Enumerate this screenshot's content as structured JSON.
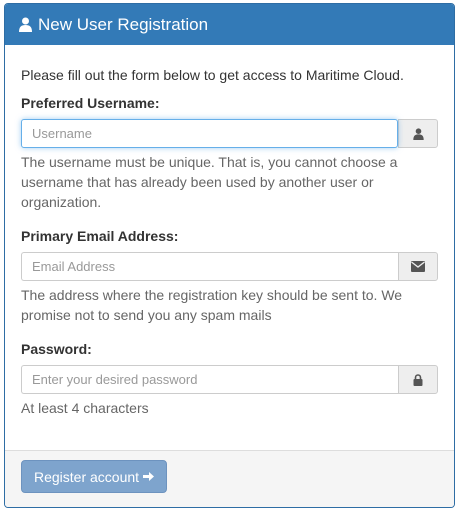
{
  "panel": {
    "title": "New User Registration",
    "title_icon": "user-icon"
  },
  "intro": "Please fill out the form below to get access to Maritime Cloud.",
  "username": {
    "label": "Preferred Username:",
    "placeholder": "Username",
    "value": "",
    "icon": "user-icon",
    "help": "The username must be unique. That is, you cannot choose a username that has already been used by another user or organization."
  },
  "email": {
    "label": "Primary Email Address:",
    "placeholder": "Email Address",
    "value": "",
    "icon": "envelope-icon",
    "help": "The address where the registration key should be sent to. We promise not to send you any spam mails"
  },
  "password": {
    "label": "Password:",
    "placeholder": "Enter your desired password",
    "value": "",
    "icon": "lock-icon",
    "help": "At least 4 characters"
  },
  "footer": {
    "register_label": "Register account",
    "register_icon": "arrow-right-icon"
  },
  "colors": {
    "heading_bg": "#337ab7",
    "button_bg": "#7ea4cd",
    "focus_border": "#66afe9"
  }
}
